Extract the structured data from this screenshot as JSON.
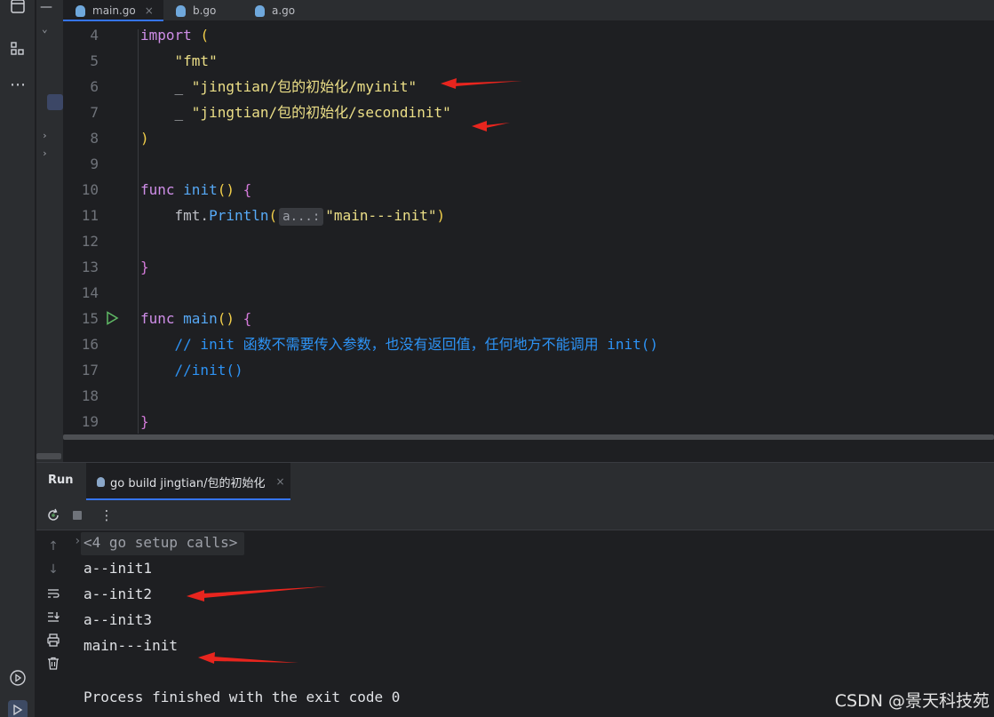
{
  "tabs": [
    {
      "label": "main.go",
      "active": true
    },
    {
      "label": "b.go",
      "active": false
    },
    {
      "label": "a.go",
      "active": false
    }
  ],
  "editor": {
    "lines": [
      {
        "num": "4",
        "parts": [
          {
            "t": "import ",
            "c": "kw"
          },
          {
            "t": "(",
            "c": "br1"
          }
        ]
      },
      {
        "num": "5",
        "parts": [
          {
            "t": "    ",
            "c": ""
          },
          {
            "t": "\"fmt\"",
            "c": "str"
          }
        ]
      },
      {
        "num": "6",
        "parts": [
          {
            "t": "    _ ",
            "c": "pkg"
          },
          {
            "t": "\"jingtian/包的初始化/myinit\"",
            "c": "str"
          }
        ]
      },
      {
        "num": "7",
        "parts": [
          {
            "t": "    _ ",
            "c": "pkg"
          },
          {
            "t": "\"jingtian/包的初始化/secondinit\"",
            "c": "str"
          }
        ]
      },
      {
        "num": "8",
        "parts": [
          {
            "t": ")",
            "c": "br1"
          }
        ]
      },
      {
        "num": "9",
        "parts": []
      },
      {
        "num": "10",
        "parts": [
          {
            "t": "func ",
            "c": "kw"
          },
          {
            "t": "init",
            "c": "fn"
          },
          {
            "t": "() ",
            "c": "br1"
          },
          {
            "t": "{",
            "c": "br2"
          }
        ]
      },
      {
        "num": "11",
        "parts": [
          {
            "t": "    fmt.",
            "c": "pkg"
          },
          {
            "t": "Println",
            "c": "call"
          },
          {
            "t": "(",
            "c": "br1"
          },
          {
            "t": "a...:",
            "c": "hint"
          },
          {
            "t": "\"main---init\"",
            "c": "str"
          },
          {
            "t": ")",
            "c": "br1"
          }
        ]
      },
      {
        "num": "12",
        "parts": []
      },
      {
        "num": "13",
        "parts": [
          {
            "t": "}",
            "c": "br2"
          }
        ]
      },
      {
        "num": "14",
        "parts": []
      },
      {
        "num": "15",
        "parts": [
          {
            "t": "func ",
            "c": "kw"
          },
          {
            "t": "main",
            "c": "fn"
          },
          {
            "t": "() ",
            "c": "br1"
          },
          {
            "t": "{",
            "c": "br2"
          }
        ]
      },
      {
        "num": "16",
        "parts": [
          {
            "t": "    // init 函数不需要传入参数，也没有返回值，任何地方不能调用 init()",
            "c": "cmt"
          }
        ]
      },
      {
        "num": "17",
        "parts": [
          {
            "t": "    //init()",
            "c": "cmt"
          }
        ]
      },
      {
        "num": "18",
        "parts": []
      },
      {
        "num": "19",
        "parts": [
          {
            "t": "}",
            "c": "br2"
          }
        ]
      }
    ]
  },
  "run": {
    "title": "Run",
    "tab_label": "go build jingtian/包的初始化",
    "output": [
      "<4 go setup calls>",
      "a--init1",
      "a--init2",
      "a--init3",
      "main---init",
      "",
      "Process finished with the exit code 0"
    ]
  },
  "watermark": "CSDN @景天科技苑",
  "colors": {
    "accent": "#3574f0",
    "arrow": "#e8251e"
  }
}
